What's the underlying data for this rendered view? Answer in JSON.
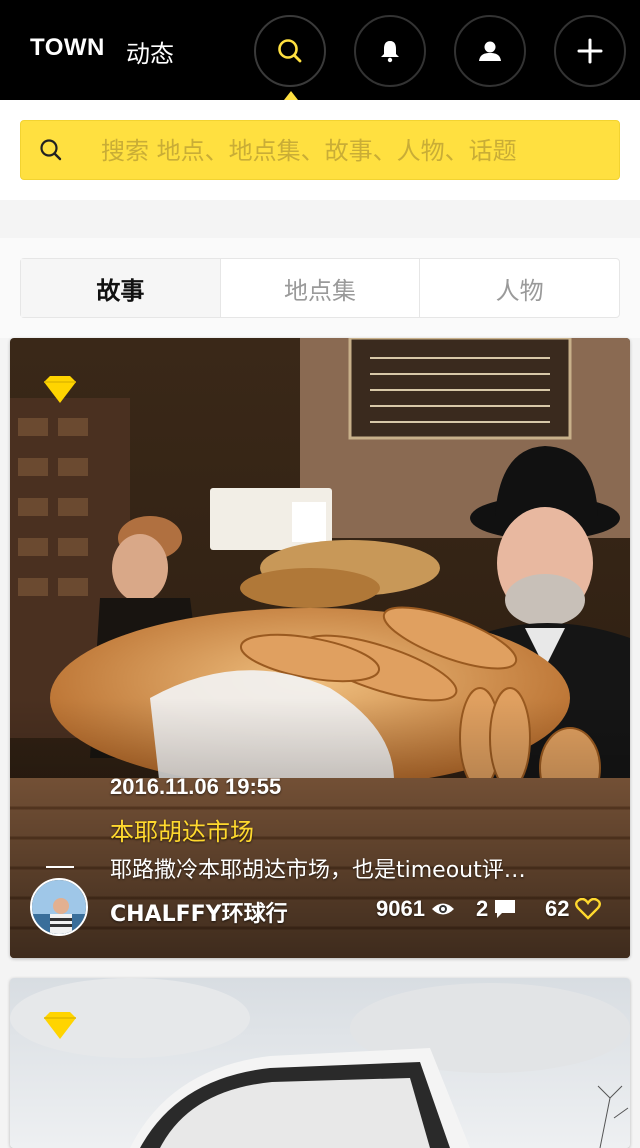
{
  "header": {
    "brand": "TOWN",
    "nav_dynamic": "动态",
    "icons": [
      "search-icon",
      "bell-icon",
      "user-icon",
      "plus-icon"
    ]
  },
  "search": {
    "placeholder": "搜索 地点、地点集、故事、人物、话题"
  },
  "tabs": [
    {
      "label": "故事",
      "active": true
    },
    {
      "label": "地点集",
      "active": false
    },
    {
      "label": "人物",
      "active": false
    }
  ],
  "cards": [
    {
      "date": "2016.11.06 19:55",
      "title": "本耶胡达市场",
      "description": "耶路撒冷本耶胡达市场，也是timeout评…",
      "author": "CHALFFY环球行",
      "views": "9061",
      "comments": "2",
      "likes": "62"
    },
    {}
  ],
  "colors": {
    "accent": "#ffe040",
    "title_yellow": "#ffd92e",
    "topbar": "#000000"
  }
}
